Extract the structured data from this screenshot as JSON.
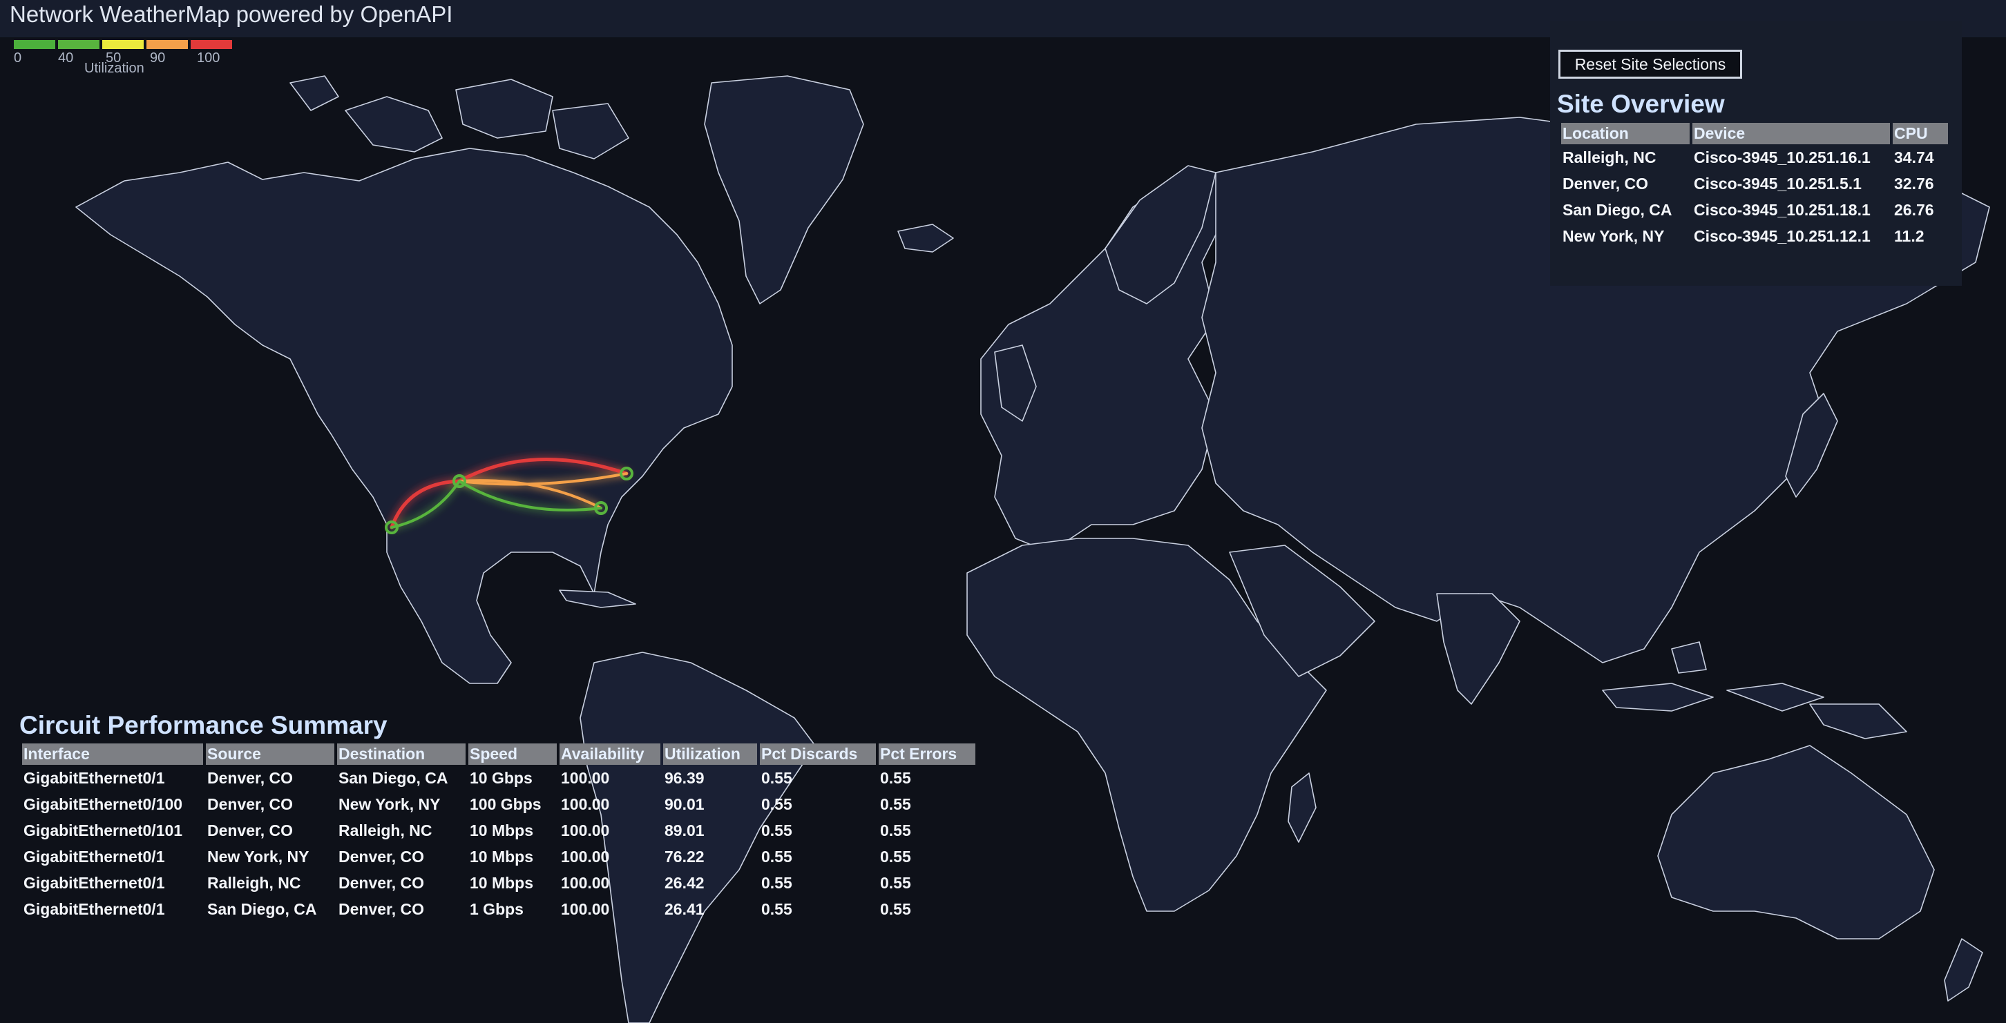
{
  "app": {
    "title": "Network WeatherMap powered by OpenAPI"
  },
  "legend": {
    "caption": "Utilization",
    "stops": [
      {
        "label": "0",
        "color": "#4caf3c"
      },
      {
        "label": "40",
        "color": "#58b43e"
      },
      {
        "label": "50",
        "color": "#ecea3d"
      },
      {
        "label": "90",
        "color": "#f4a04a"
      },
      {
        "label": "100",
        "color": "#e23a3a"
      }
    ]
  },
  "site_panel": {
    "reset_label": "Reset Site Selections",
    "title": "Site Overview",
    "columns": [
      "Location",
      "Device",
      "CPU"
    ],
    "rows": [
      [
        "Ralleigh, NC",
        "Cisco-3945_10.251.16.1",
        "34.74"
      ],
      [
        "Denver, CO",
        "Cisco-3945_10.251.5.1",
        "32.76"
      ],
      [
        "San Diego, CA",
        "Cisco-3945_10.251.18.1",
        "26.76"
      ],
      [
        "New York, NY",
        "Cisco-3945_10.251.12.1",
        "11.2"
      ]
    ]
  },
  "circuit_panel": {
    "title": "Circuit Performance Summary",
    "columns": [
      "Interface",
      "Source",
      "Destination",
      "Speed",
      "Availability",
      "Utilization",
      "Pct Discards",
      "Pct Errors"
    ],
    "rows": [
      [
        "GigabitEthernet0/1",
        "Denver, CO",
        "San Diego, CA",
        "10 Gbps",
        "100.00",
        "96.39",
        "0.55",
        "0.55"
      ],
      [
        "GigabitEthernet0/100",
        "Denver, CO",
        "New York, NY",
        "100 Gbps",
        "100.00",
        "90.01",
        "0.55",
        "0.55"
      ],
      [
        "GigabitEthernet0/101",
        "Denver, CO",
        "Ralleigh, NC",
        "10 Mbps",
        "100.00",
        "89.01",
        "0.55",
        "0.55"
      ],
      [
        "GigabitEthernet0/1",
        "New York, NY",
        "Denver, CO",
        "10 Mbps",
        "100.00",
        "76.22",
        "0.55",
        "0.55"
      ],
      [
        "GigabitEthernet0/1",
        "Ralleigh, NC",
        "Denver, CO",
        "10 Mbps",
        "100.00",
        "26.42",
        "0.55",
        "0.55"
      ],
      [
        "GigabitEthernet0/1",
        "San Diego, CA",
        "Denver, CO",
        "1 Gbps",
        "100.00",
        "26.41",
        "0.55",
        "0.55"
      ]
    ]
  },
  "map": {
    "ocean_color": "#0e1119",
    "land_color": "#1a2034",
    "border_color": "#c9d0e0",
    "link_colors": {
      "high": "#e23a3a",
      "upper": "#f4a04a",
      "low": "#58b43e"
    },
    "sites": [
      {
        "name": "Denver, CO"
      },
      {
        "name": "San Diego, CA"
      },
      {
        "name": "New York, NY"
      },
      {
        "name": "Ralleigh, NC"
      }
    ]
  }
}
